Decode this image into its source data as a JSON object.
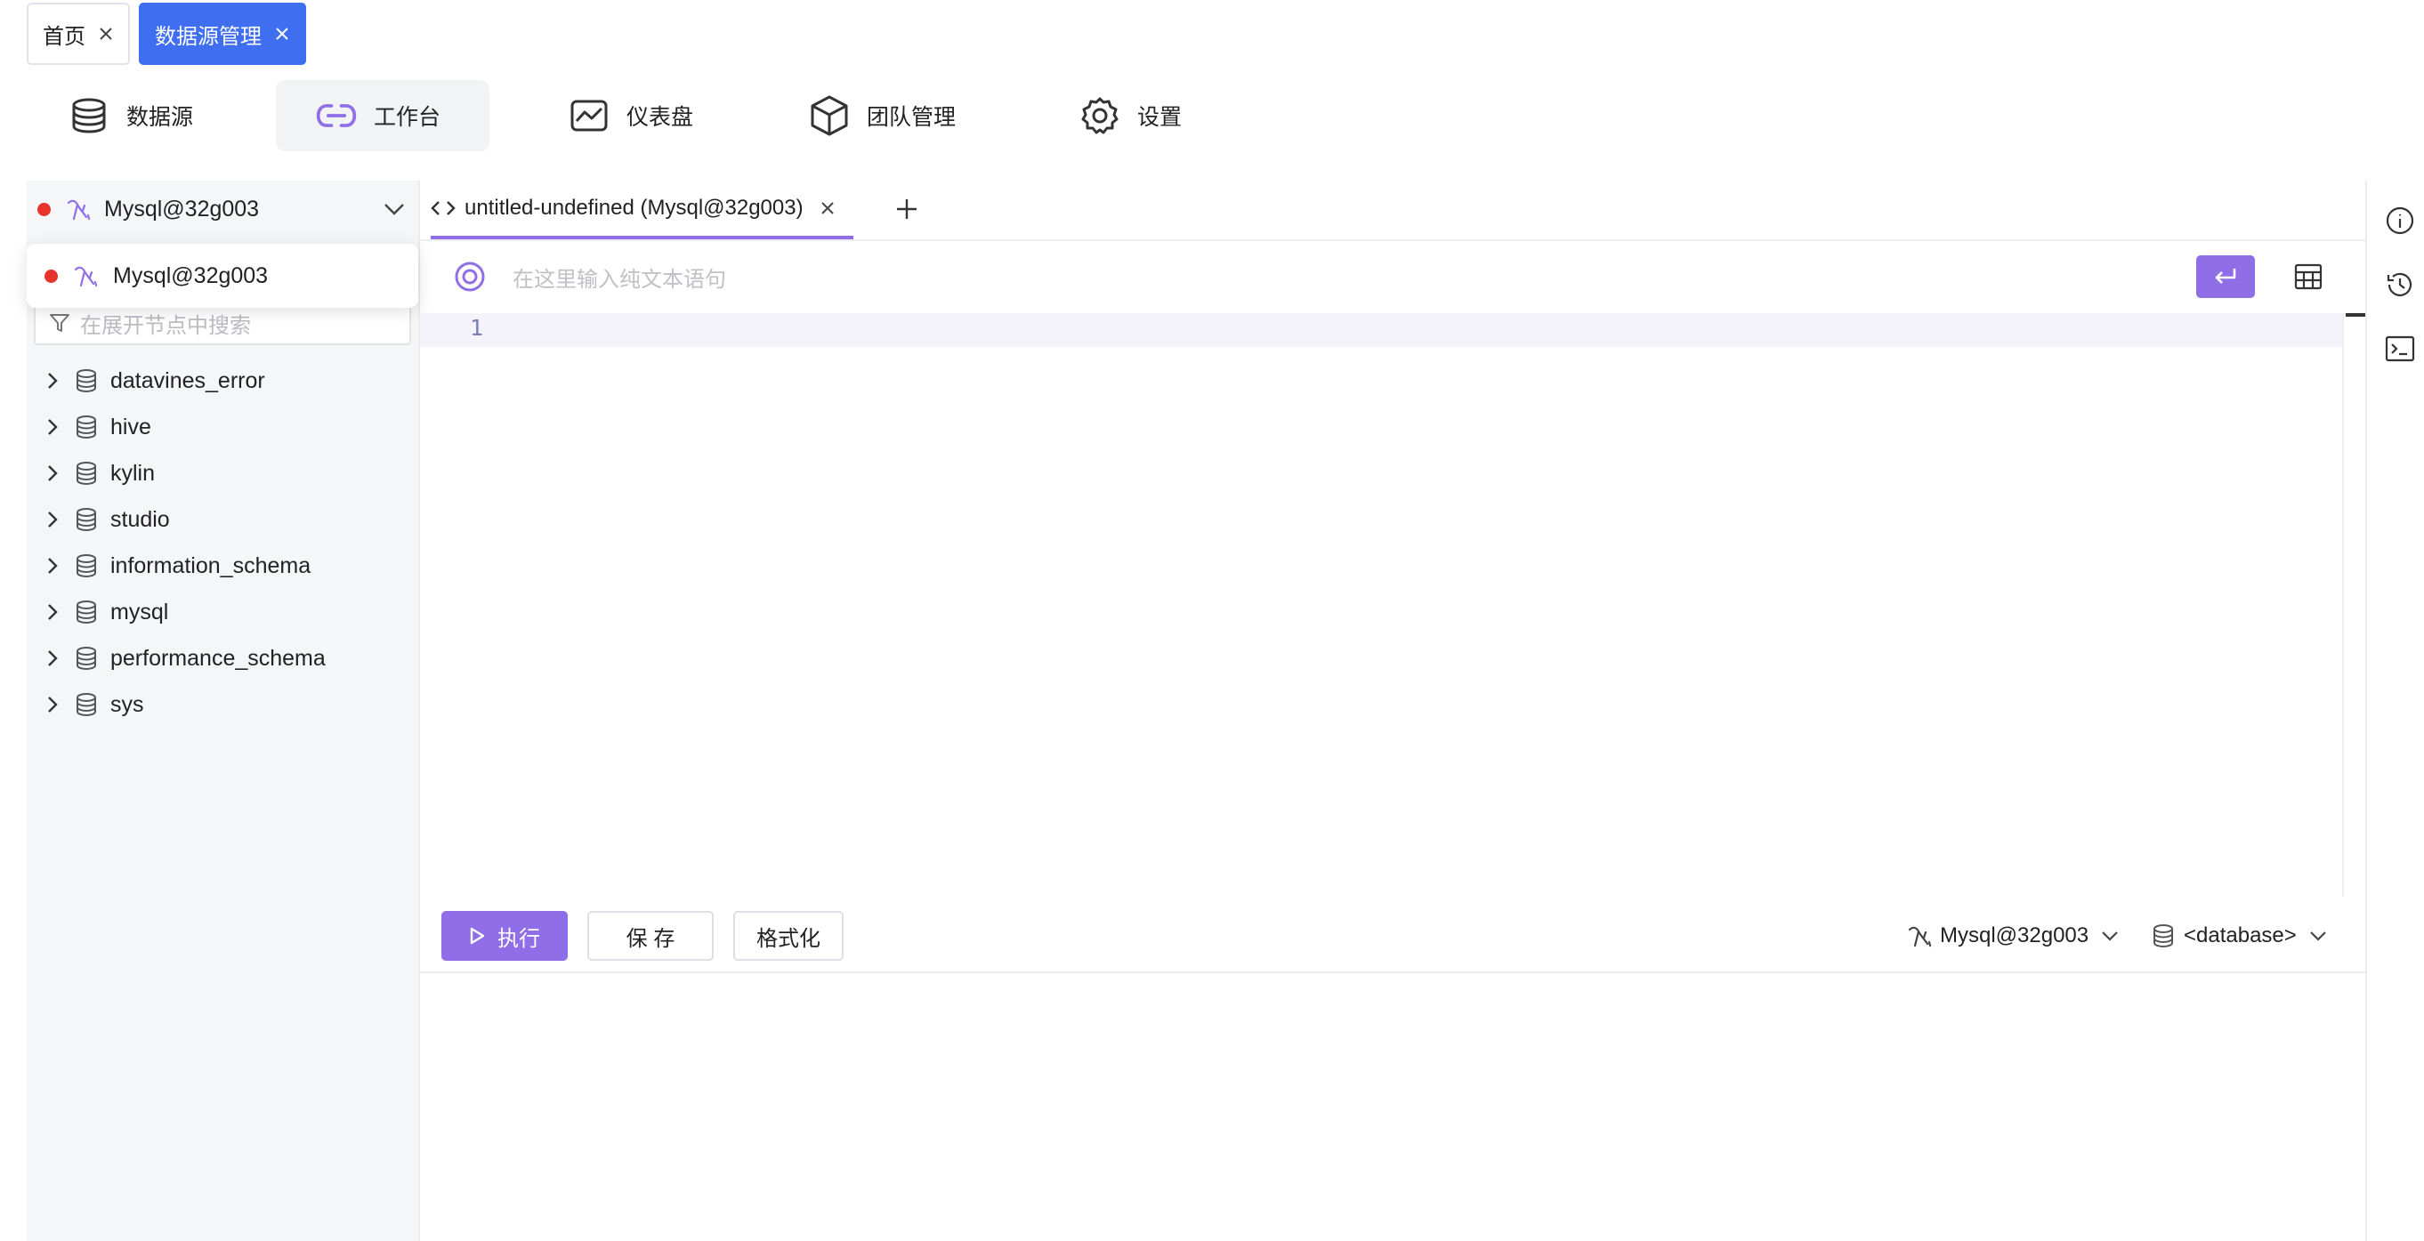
{
  "page_tabs": [
    {
      "label": "首页",
      "active": false
    },
    {
      "label": "数据源管理",
      "active": true
    }
  ],
  "nav": [
    {
      "label": "数据源",
      "icon": "database-icon"
    },
    {
      "label": "工作台",
      "icon": "link-icon",
      "active": true
    },
    {
      "label": "仪表盘",
      "icon": "chart-icon"
    },
    {
      "label": "团队管理",
      "icon": "cube-icon"
    },
    {
      "label": "设置",
      "icon": "gear-icon"
    }
  ],
  "datasource": {
    "selected": "Mysql@32g003",
    "dropdown_option": "Mysql@32g003",
    "status_color": "#e8332c"
  },
  "filter": {
    "placeholder": "在展开节点中搜索"
  },
  "tree": [
    "datavines_error",
    "hive",
    "kylin",
    "studio",
    "information_schema",
    "mysql",
    "performance_schema",
    "sys"
  ],
  "editor": {
    "tab_label": "untitled-undefined (Mysql@32g003)",
    "nl_placeholder": "在这里输入纯文本语句",
    "line_numbers": [
      "1"
    ]
  },
  "toolbar": {
    "run_label": "执行",
    "save_label": "保 存",
    "format_label": "格式化",
    "connection": "Mysql@32g003",
    "database": "<database>"
  },
  "colors": {
    "accent": "#8f6ee8",
    "primary_blue": "#3f6ff0",
    "panel_bg": "#f5f6f8"
  }
}
